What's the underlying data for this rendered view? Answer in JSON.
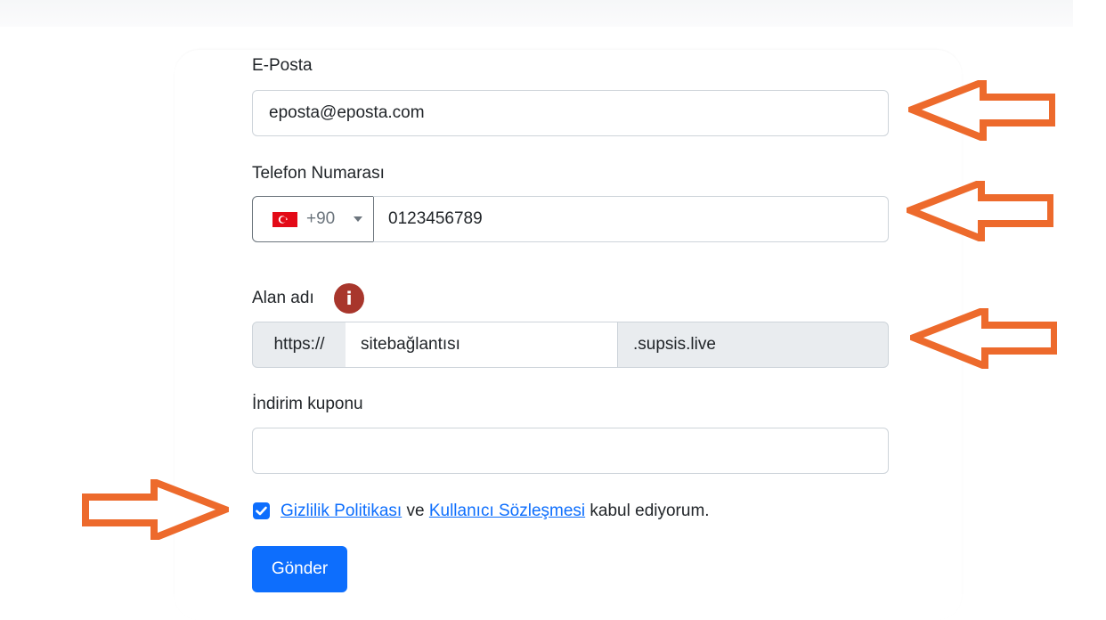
{
  "form": {
    "email": {
      "label": "E-Posta",
      "value": "eposta@eposta.com"
    },
    "phone": {
      "label": "Telefon Numarası",
      "country_flag": "turkey-flag-icon",
      "dial_code": "+90",
      "value": "0123456789"
    },
    "domain": {
      "label": "Alan adı",
      "info_icon": "i",
      "prefix": "https://",
      "value": "sitebağlantısı",
      "suffix": ".supsis.live"
    },
    "coupon": {
      "label": "İndirim kuponu",
      "value": ""
    },
    "consent": {
      "checked": true,
      "privacy_link": "Gizlilik Politikası",
      "conjunction": "ve",
      "terms_link": "Kullanıcı Sözleşmesi",
      "suffix_text": "kabul ediyorum."
    },
    "submit_label": "Gönder"
  },
  "colors": {
    "primary": "#0d6efd",
    "info_icon": "#a8362c",
    "annotation_arrow": "#ed6a2c",
    "addon_background": "#e9ecef"
  }
}
